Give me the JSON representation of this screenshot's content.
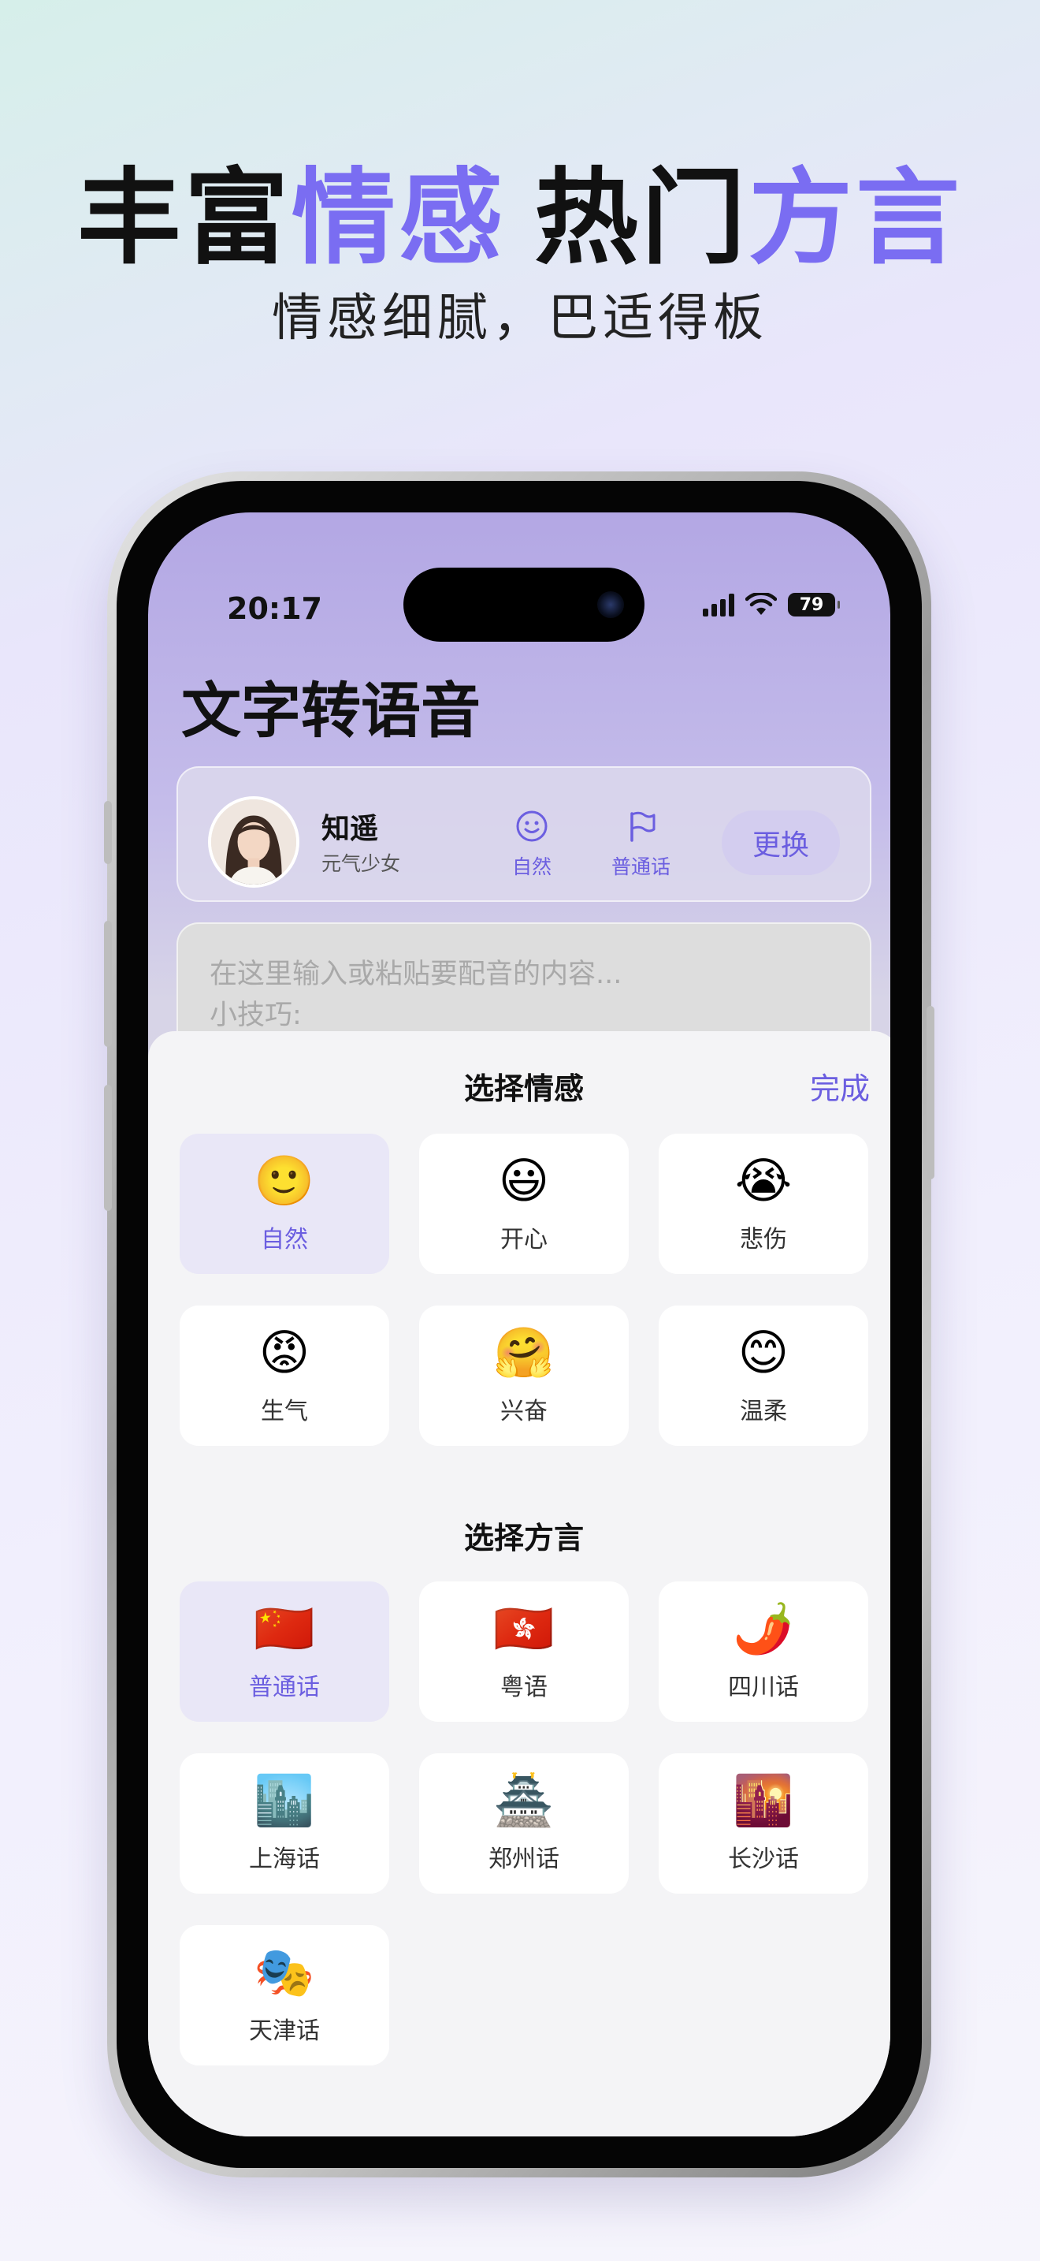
{
  "banner": {
    "title_part1": "丰富",
    "title_part2": "情感",
    "title_part3": "热门",
    "title_part4": "方言",
    "subtitle": "情感细腻，巴适得板",
    "accent_color": "#7a6df2"
  },
  "status_bar": {
    "time": "20:17",
    "battery": "79"
  },
  "app": {
    "title": "文字转语音"
  },
  "voice": {
    "name": "知遥",
    "description": "元气少女",
    "emotion_label": "自然",
    "dialect_label": "普通话",
    "change_label": "更换"
  },
  "editor": {
    "placeholder_line1": "在这里输入或粘贴要配音的内容...",
    "placeholder_line2": "小技巧:"
  },
  "sheet": {
    "emotion_title": "选择情感",
    "done_label": "完成",
    "dialect_title": "选择方言",
    "emotions": [
      {
        "emoji": "🙂",
        "label": "自然",
        "selected": true
      },
      {
        "emoji": "😃",
        "label": "开心",
        "selected": false
      },
      {
        "emoji": "😭",
        "label": "悲伤",
        "selected": false
      },
      {
        "emoji": "😡",
        "label": "生气",
        "selected": false
      },
      {
        "emoji": "🤗",
        "label": "兴奋",
        "selected": false
      },
      {
        "emoji": "😊",
        "label": "温柔",
        "selected": false
      }
    ],
    "dialects": [
      {
        "emoji": "🇨🇳",
        "label": "普通话",
        "selected": true
      },
      {
        "emoji": "🇭🇰",
        "label": "粤语",
        "selected": false
      },
      {
        "emoji": "🌶️",
        "label": "四川话",
        "selected": false
      },
      {
        "emoji": "🏙️",
        "label": "上海话",
        "selected": false
      },
      {
        "emoji": "🏯",
        "label": "郑州话",
        "selected": false
      },
      {
        "emoji": "🌇",
        "label": "长沙话",
        "selected": false
      },
      {
        "emoji": "🎭",
        "label": "天津话",
        "selected": false
      }
    ]
  },
  "colors": {
    "accent": "#6b5ee0",
    "selected_tile": "#e9e7f7"
  }
}
